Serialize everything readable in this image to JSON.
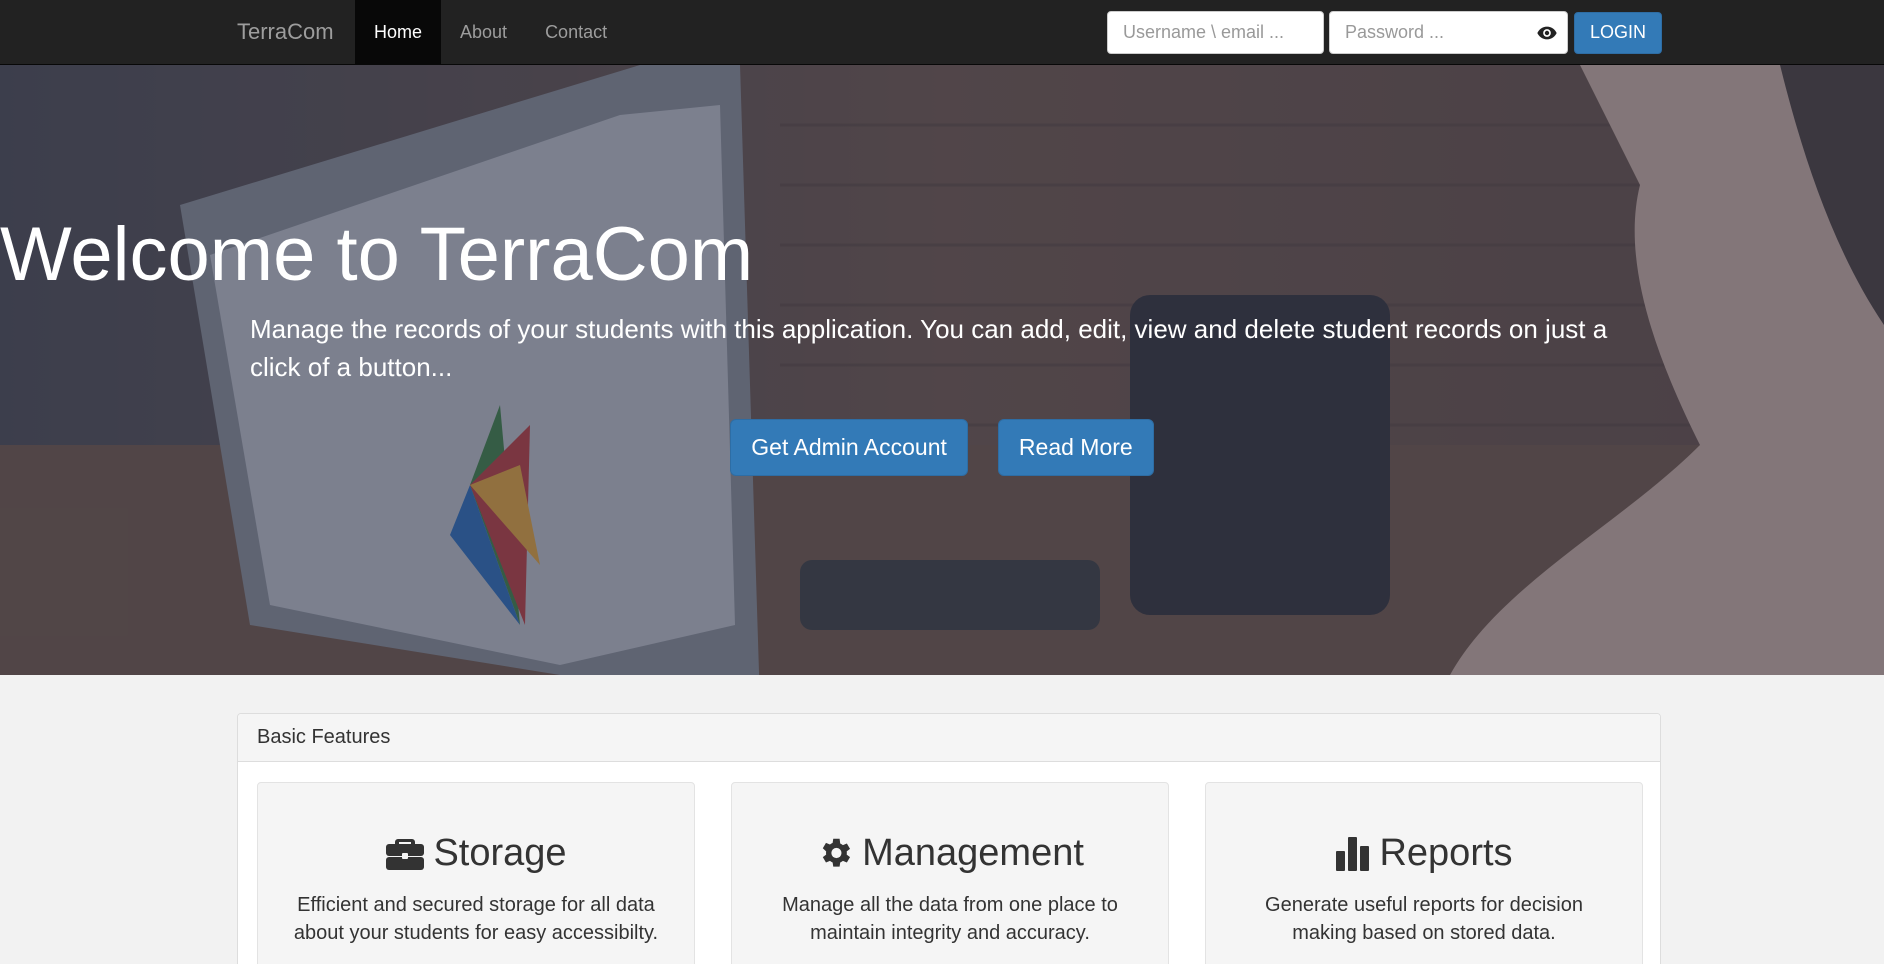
{
  "navbar": {
    "brand": "TerraCom",
    "links": [
      {
        "label": "Home",
        "active": true
      },
      {
        "label": "About",
        "active": false
      },
      {
        "label": "Contact",
        "active": false
      }
    ],
    "username_placeholder": "Username \\ email ...",
    "password_placeholder": "Password ...",
    "login_label": "LOGIN",
    "password_toggle_icon": "eye-icon"
  },
  "hero": {
    "title": "Welcome to TerraCom",
    "subtitle": "Manage the records of your students with this application. You can add, edit, view and delete student records on just a click of a button...",
    "buttons": [
      "Get Admin Account",
      "Read More"
    ]
  },
  "features": {
    "heading": "Basic Features",
    "items": [
      {
        "icon": "briefcase-icon",
        "title": "Storage",
        "text": "Efficient and secured storage for all data about your students for easy accessibilty."
      },
      {
        "icon": "gear-icon",
        "title": "Management",
        "text": "Manage all the data from one place to maintain integrity and accuracy."
      },
      {
        "icon": "bar-chart-icon",
        "title": "Reports",
        "text": "Generate useful reports for decision making based on stored data."
      }
    ]
  },
  "colors": {
    "navbar_bg": "#222222",
    "primary": "#337ab7",
    "page_bg": "#f2f2f2"
  }
}
